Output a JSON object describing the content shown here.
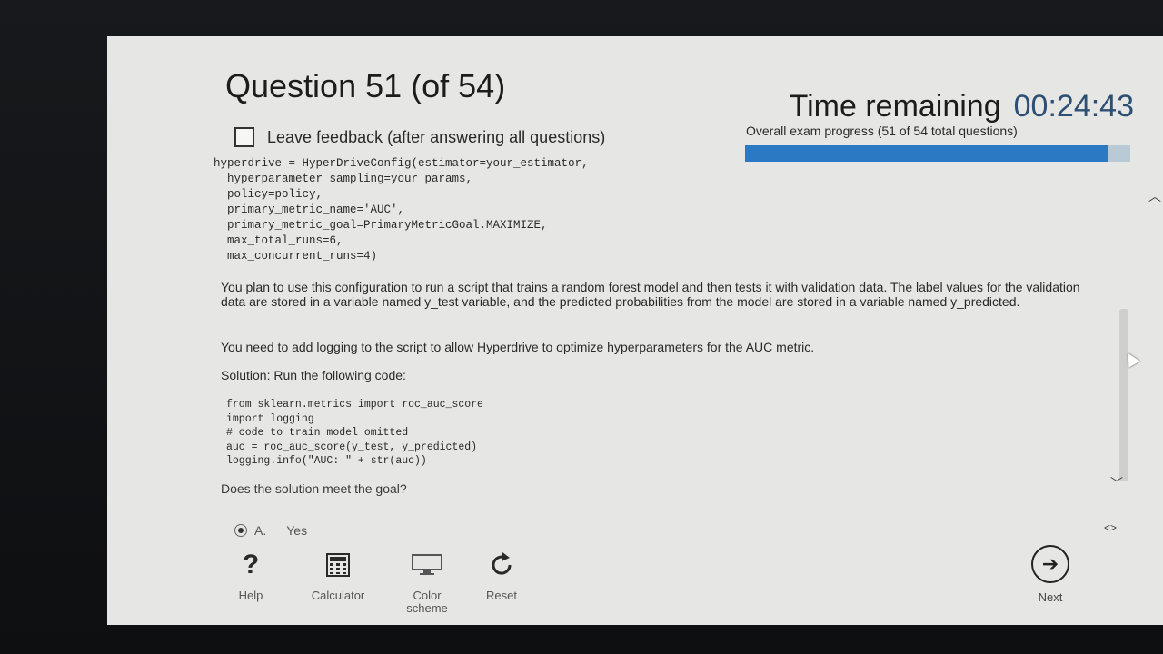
{
  "exam": {
    "question_title": "Question 51 (of 54)",
    "time_label": "Time remaining",
    "time_value": "00:24:43",
    "progress_label": "Overall exam progress (51 of 54 total questions)",
    "progress_fraction": 0.944,
    "feedback_label": "Leave feedback (after answering all questions)"
  },
  "question": {
    "config_code": "hyperdrive = HyperDriveConfig(estimator=your_estimator,\n  hyperparameter_sampling=your_params,\n  policy=policy,\n  primary_metric_name='AUC',\n  primary_metric_goal=PrimaryMetricGoal.MAXIMIZE,\n  max_total_runs=6,\n  max_concurrent_runs=4)",
    "para1": "You plan to use this configuration to run a script that trains a random forest model and then tests it with validation data. The label values for the validation data are stored in a variable named y_test variable, and the predicted probabilities from the model are stored in a variable named y_predicted.",
    "para2": "You need to add logging to the script to allow Hyperdrive to optimize hyperparameters for the AUC metric.",
    "para3": "Solution: Run the following code:",
    "solution_code": "from sklearn.metrics import roc_auc_score\nimport logging\n# code to train model omitted\nauc = roc_auc_score(y_test, y_predicted)\nlogging.info(\"AUC: \" + str(auc))",
    "prompt": "Does the solution meet the goal?"
  },
  "answer": {
    "letter": "A.",
    "text": "Yes"
  },
  "toolbar": {
    "help_icon": "?",
    "help_label": "Help",
    "calculator_label": "Calculator",
    "color_label": "Color scheme",
    "reset_label": "Reset",
    "next_label": "Next"
  },
  "colors": {
    "progress_fill": "#2b79c2",
    "clock": "#2c4f73"
  }
}
